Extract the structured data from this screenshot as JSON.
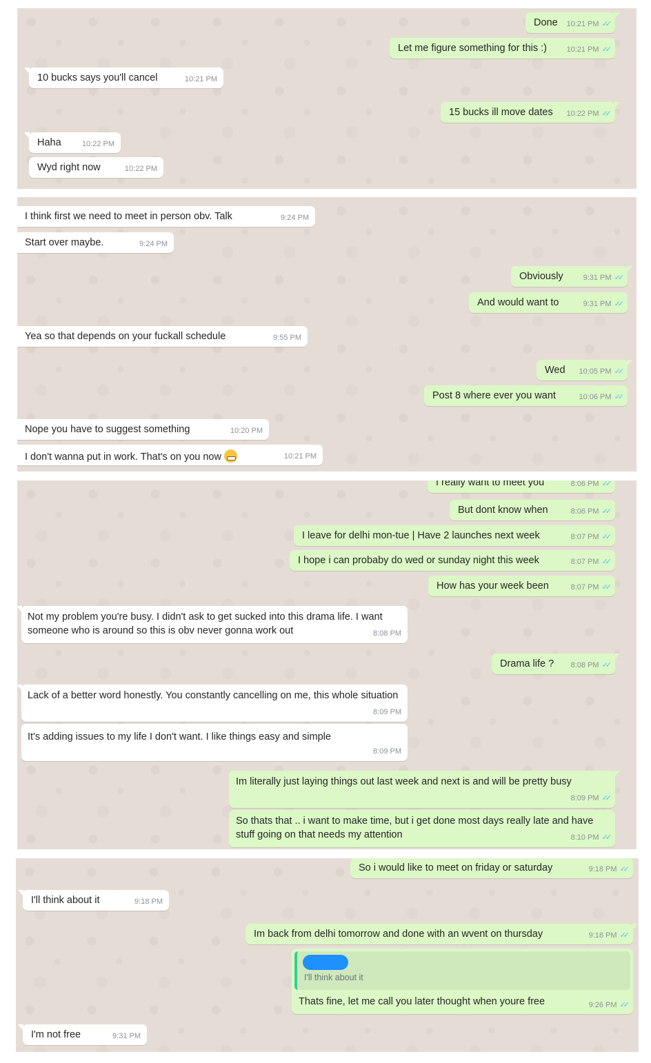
{
  "panel1": {
    "done": {
      "text": "Done",
      "time": "10:21 PM"
    },
    "figure": {
      "text": "Let me figure something for this :)",
      "time": "10:21 PM"
    },
    "cancel": {
      "text": "10 bucks says you'll cancel",
      "time": "10:21 PM"
    },
    "move": {
      "text": "15 bucks ill move dates",
      "time": "10:22 PM"
    },
    "haha": {
      "text": "Haha",
      "time": "10:22 PM"
    },
    "wyd": {
      "text": "Wyd right now",
      "time": "10:22 PM"
    }
  },
  "panel2": {
    "meet": {
      "text": "I think first we need to meet in person obv. Talk",
      "time": "9:24 PM"
    },
    "start": {
      "text": "Start over maybe.",
      "time": "9:24 PM"
    },
    "obviously": {
      "text": "Obviously",
      "time": "9:31 PM"
    },
    "would": {
      "text": "And would want to",
      "time": "9:31 PM"
    },
    "yea": {
      "text": "Yea so that depends on your fuckall schedule",
      "time": "9:55 PM"
    },
    "wed": {
      "text": "Wed",
      "time": "10:05 PM"
    },
    "post8": {
      "text": "Post 8 where ever you want",
      "time": "10:06 PM"
    },
    "nope": {
      "text": "Nope you have to suggest something",
      "time": "10:20 PM"
    },
    "work": {
      "text": "I don't wanna put in work. That's on you now",
      "emoji": "grimacing-face-emoji",
      "time": "10:21 PM"
    }
  },
  "panel3": {
    "really": {
      "text": "I really want to meet you",
      "time": "8:06 PM"
    },
    "when": {
      "text": "But dont know when",
      "time": "8:06 PM"
    },
    "delhi": {
      "text": "I leave for delhi mon-tue | Have 2 launches next week",
      "time": "8:07 PM"
    },
    "hope": {
      "text": "I hope i can probaby do wed or sunday night this week",
      "time": "8:07 PM"
    },
    "week": {
      "text": "How has your week been",
      "time": "8:07 PM"
    },
    "problem": {
      "text": "Not my problem you're busy. I didn't ask to get sucked into this drama life. I want someone who is around so this is obv never gonna work out",
      "time": "8:08 PM"
    },
    "drama": {
      "text": "Drama life ?",
      "time": "8:08 PM"
    },
    "lack": {
      "text": "Lack of a better word honestly. You constantly cancelling on me, this whole situation",
      "time": "8:09 PM"
    },
    "issues": {
      "text": "It's adding issues to my life I don't want. I like things easy and simple",
      "time": "8:09 PM"
    },
    "literally": {
      "text": "Im literally just laying things out last week and next is and will be pretty busy",
      "time": "8:09 PM"
    },
    "thats": {
      "text": "So thats that .. i want to make time, but i get done most days really late and have stuff going on that needs my attention",
      "time": "8:10 PM"
    }
  },
  "panel4": {
    "friday": {
      "text": "So i would like to meet on friday or saturday",
      "time": "9:18 PM"
    },
    "think": {
      "text": "I'll think about it",
      "time": "9:18 PM"
    },
    "back": {
      "text": "Im back from delhi tomorrow and done with an wvent on thursday",
      "time": "9:18 PM"
    },
    "quote": {
      "text": "I'll think about it"
    },
    "fine": {
      "text": "Thats fine, let me call you later thought when youre free",
      "time": "9:26 PM"
    },
    "notfree": {
      "text": "I'm not free",
      "time": "9:31 PM"
    }
  },
  "colors": {
    "chat_bg": "#e5ddd5",
    "incoming": "#ffffff",
    "outgoing": "#dcf8c6",
    "read_ticks": "#4fc3f7",
    "redaction": "#1e90ff"
  },
  "icons": {
    "read_receipt": "double-check-icon"
  }
}
